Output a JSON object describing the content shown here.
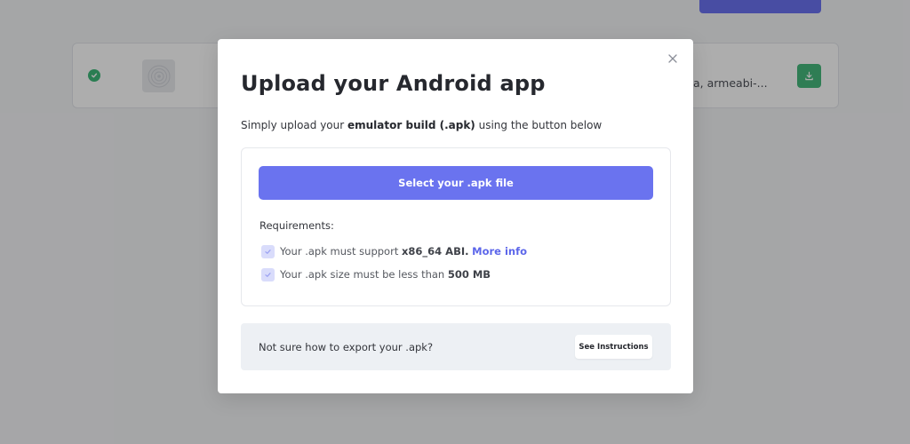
{
  "background": {
    "row": {
      "abi_text": "a, armeabi-..."
    }
  },
  "modal": {
    "title": "Upload your Android app",
    "subtitle": {
      "prefix": "Simply upload your ",
      "bold": "emulator build (.apk)",
      "suffix": " using the button below"
    },
    "select_button_label": "Select your .apk file",
    "requirements": {
      "title": "Requirements:",
      "items": [
        {
          "prefix": "Your .apk must support ",
          "bold": "x86_64 ABI.",
          "link": "More info"
        },
        {
          "prefix": "Your .apk size must be less than ",
          "bold": "500 MB"
        }
      ]
    },
    "export": {
      "text": "Not sure how to export your .apk?",
      "button_label": "See Instructions"
    }
  },
  "icons": {
    "close": "close-icon",
    "check": "check-icon",
    "download": "download-icon",
    "app_thumbnail": "app-thumbnail-icon",
    "status": "success-check-icon"
  },
  "colors": {
    "accent": "#6a73ef",
    "link": "#5c66ea",
    "success": "#3fb97a",
    "checkbox_bg": "#d9dcfb",
    "export_bg": "#edf0f4"
  }
}
